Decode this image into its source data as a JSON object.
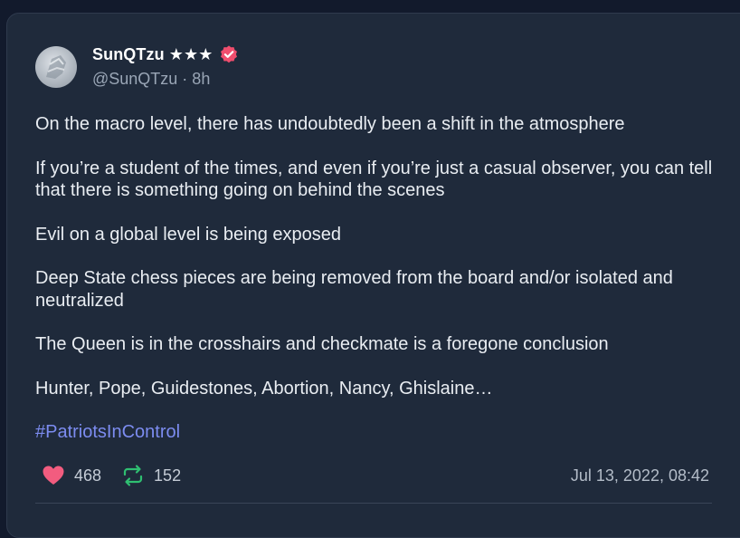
{
  "post": {
    "author": {
      "display_name": "SunQTzu ★★★",
      "handle_line": "@SunQTzu · 8h"
    },
    "paragraphs": [
      "On the macro level, there has undoubtedly been a shift in the atmosphere",
      "If you’re a student of the times, and even if you’re just a casual observer, you can tell that there is something going on behind the scenes",
      "Evil on a global level is being exposed",
      "Deep State chess pieces are being removed from the board and/or isolated and neutralized",
      "The Queen is in the crosshairs and checkmate is a foregone conclusion",
      "Hunter, Pope, Guidestones, Abortion, Nancy, Ghislaine…"
    ],
    "hashtag": "#PatriotsInControl",
    "likes": "468",
    "reposts": "152",
    "timestamp": "Jul 13, 2022, 08:42"
  },
  "colors": {
    "background": "#121a2c",
    "card": "#1f2a3b",
    "like": "#f25c7f",
    "repost": "#2fbf71",
    "hashtag": "#7c8cf0",
    "verified": "#f04e6e"
  },
  "icons": {
    "verified": "verified-badge-icon",
    "like": "heart-icon",
    "repost": "repost-icon"
  }
}
